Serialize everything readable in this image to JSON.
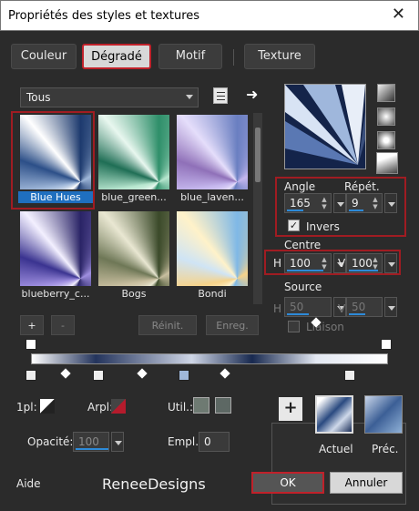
{
  "window": {
    "title": "Propriétés des styles et textures",
    "close": "✕"
  },
  "tabs": [
    "Couleur",
    "Dégradé",
    "Motif",
    "Texture"
  ],
  "dropdown": {
    "value": "Tous"
  },
  "gallery": [
    {
      "label": "Blue Hues",
      "colors": [
        "#ffffff",
        "#1d3a6e",
        "#9fb7d9",
        "#2c4f88"
      ]
    },
    {
      "label": "blue_green...",
      "colors": [
        "#e8f7ef",
        "#2f8f6a",
        "#b7e6cf",
        "#1f6e55"
      ]
    },
    {
      "label": "blue_laven...",
      "colors": [
        "#e5defb",
        "#6a7fc1",
        "#c5b7ee",
        "#8f70b8"
      ]
    },
    {
      "label": "blueberry_c...",
      "colors": [
        "#f3f0ff",
        "#2a2466",
        "#9f8fe0",
        "#3a3390"
      ]
    },
    {
      "label": "Bogs",
      "colors": [
        "#e9e7d2",
        "#3b4a2a",
        "#c9bfa0",
        "#6e7756"
      ]
    },
    {
      "label": "Bondi",
      "colors": [
        "#fff2c9",
        "#7fb8e6",
        "#f6d38a",
        "#cfe4f5"
      ]
    }
  ],
  "gallery_buttons": {
    "add": "+",
    "remove": "-",
    "reset": "Réinit.",
    "save": "Enreg."
  },
  "angle": {
    "label": "Angle",
    "value": "165"
  },
  "repeat": {
    "label": "Répét.",
    "value": "9"
  },
  "invert": {
    "label": "Invers",
    "checked": true
  },
  "center": {
    "label": "Centre",
    "h_label": "H",
    "h_value": "100",
    "v_label": "V",
    "v_value": "100"
  },
  "source": {
    "label": "Source",
    "h_label": "H",
    "h_value": "50",
    "v_label": "V",
    "v_value": "50",
    "link_label": "Liaison"
  },
  "bottom": {
    "one_plane": "1pl:",
    "arpl": "Arpl:",
    "util": "Util.:",
    "opacity_label": "Opacité:",
    "opacity_value": "100",
    "empl_label": "Empl.:",
    "empl_value": "0",
    "current": "Actuel",
    "prev": "Préc.",
    "add": "+"
  },
  "footer": {
    "help": "Aide",
    "brand": "ReneeDesigns",
    "ok": "OK",
    "cancel": "Annuler"
  }
}
